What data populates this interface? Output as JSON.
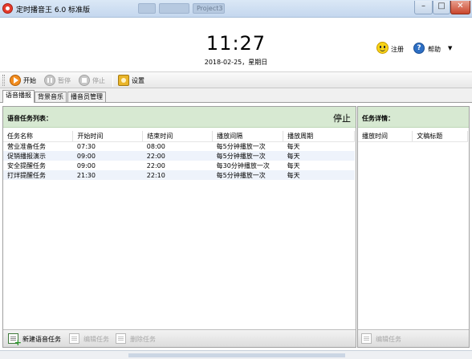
{
  "window": {
    "title": "定时播音王 6.0 标准版",
    "blur_tabs": [
      "",
      "",
      "Project3"
    ]
  },
  "header": {
    "time": "11:27",
    "date": "2018-02-25，星期日",
    "register_label": "注册",
    "help_label": "帮助"
  },
  "toolbar": {
    "start_label": "开始",
    "pause_label": "暂停",
    "stop_label": "停止",
    "settings_label": "设置"
  },
  "tabs": [
    {
      "label": "语音播报",
      "active": true
    },
    {
      "label": "背景音乐",
      "active": false
    },
    {
      "label": "播音员管理",
      "active": false
    }
  ],
  "task_panel": {
    "title": "语音任务列表：",
    "status": "停止",
    "columns": [
      "任务名称",
      "开始时间",
      "结束时间",
      "播放间隔",
      "播放周期"
    ],
    "rows": [
      [
        "营业准备任务",
        "07:30",
        "08:00",
        "每5分钟播放一次",
        "每天"
      ],
      [
        "促销播报演示",
        "09:00",
        "22:00",
        "每5分钟播放一次",
        "每天"
      ],
      [
        "安全提醒任务",
        "09:00",
        "22:00",
        "每30分钟播放一次",
        "每天"
      ],
      [
        "打烊提醒任务",
        "21:30",
        "22:10",
        "每5分钟播放一次",
        "每天"
      ]
    ],
    "footer": {
      "new_label": "新建语音任务",
      "edit_label": "编辑任务",
      "delete_label": "删除任务"
    }
  },
  "detail_panel": {
    "title": "任务详情：",
    "columns": [
      "播放时间",
      "文稿标题"
    ],
    "footer": {
      "edit_label": "编辑任务"
    }
  },
  "colors": {
    "panel_header": "#d7e9d2",
    "accent_orange": "#f28c1e",
    "row_alt": "#eef3fb"
  }
}
